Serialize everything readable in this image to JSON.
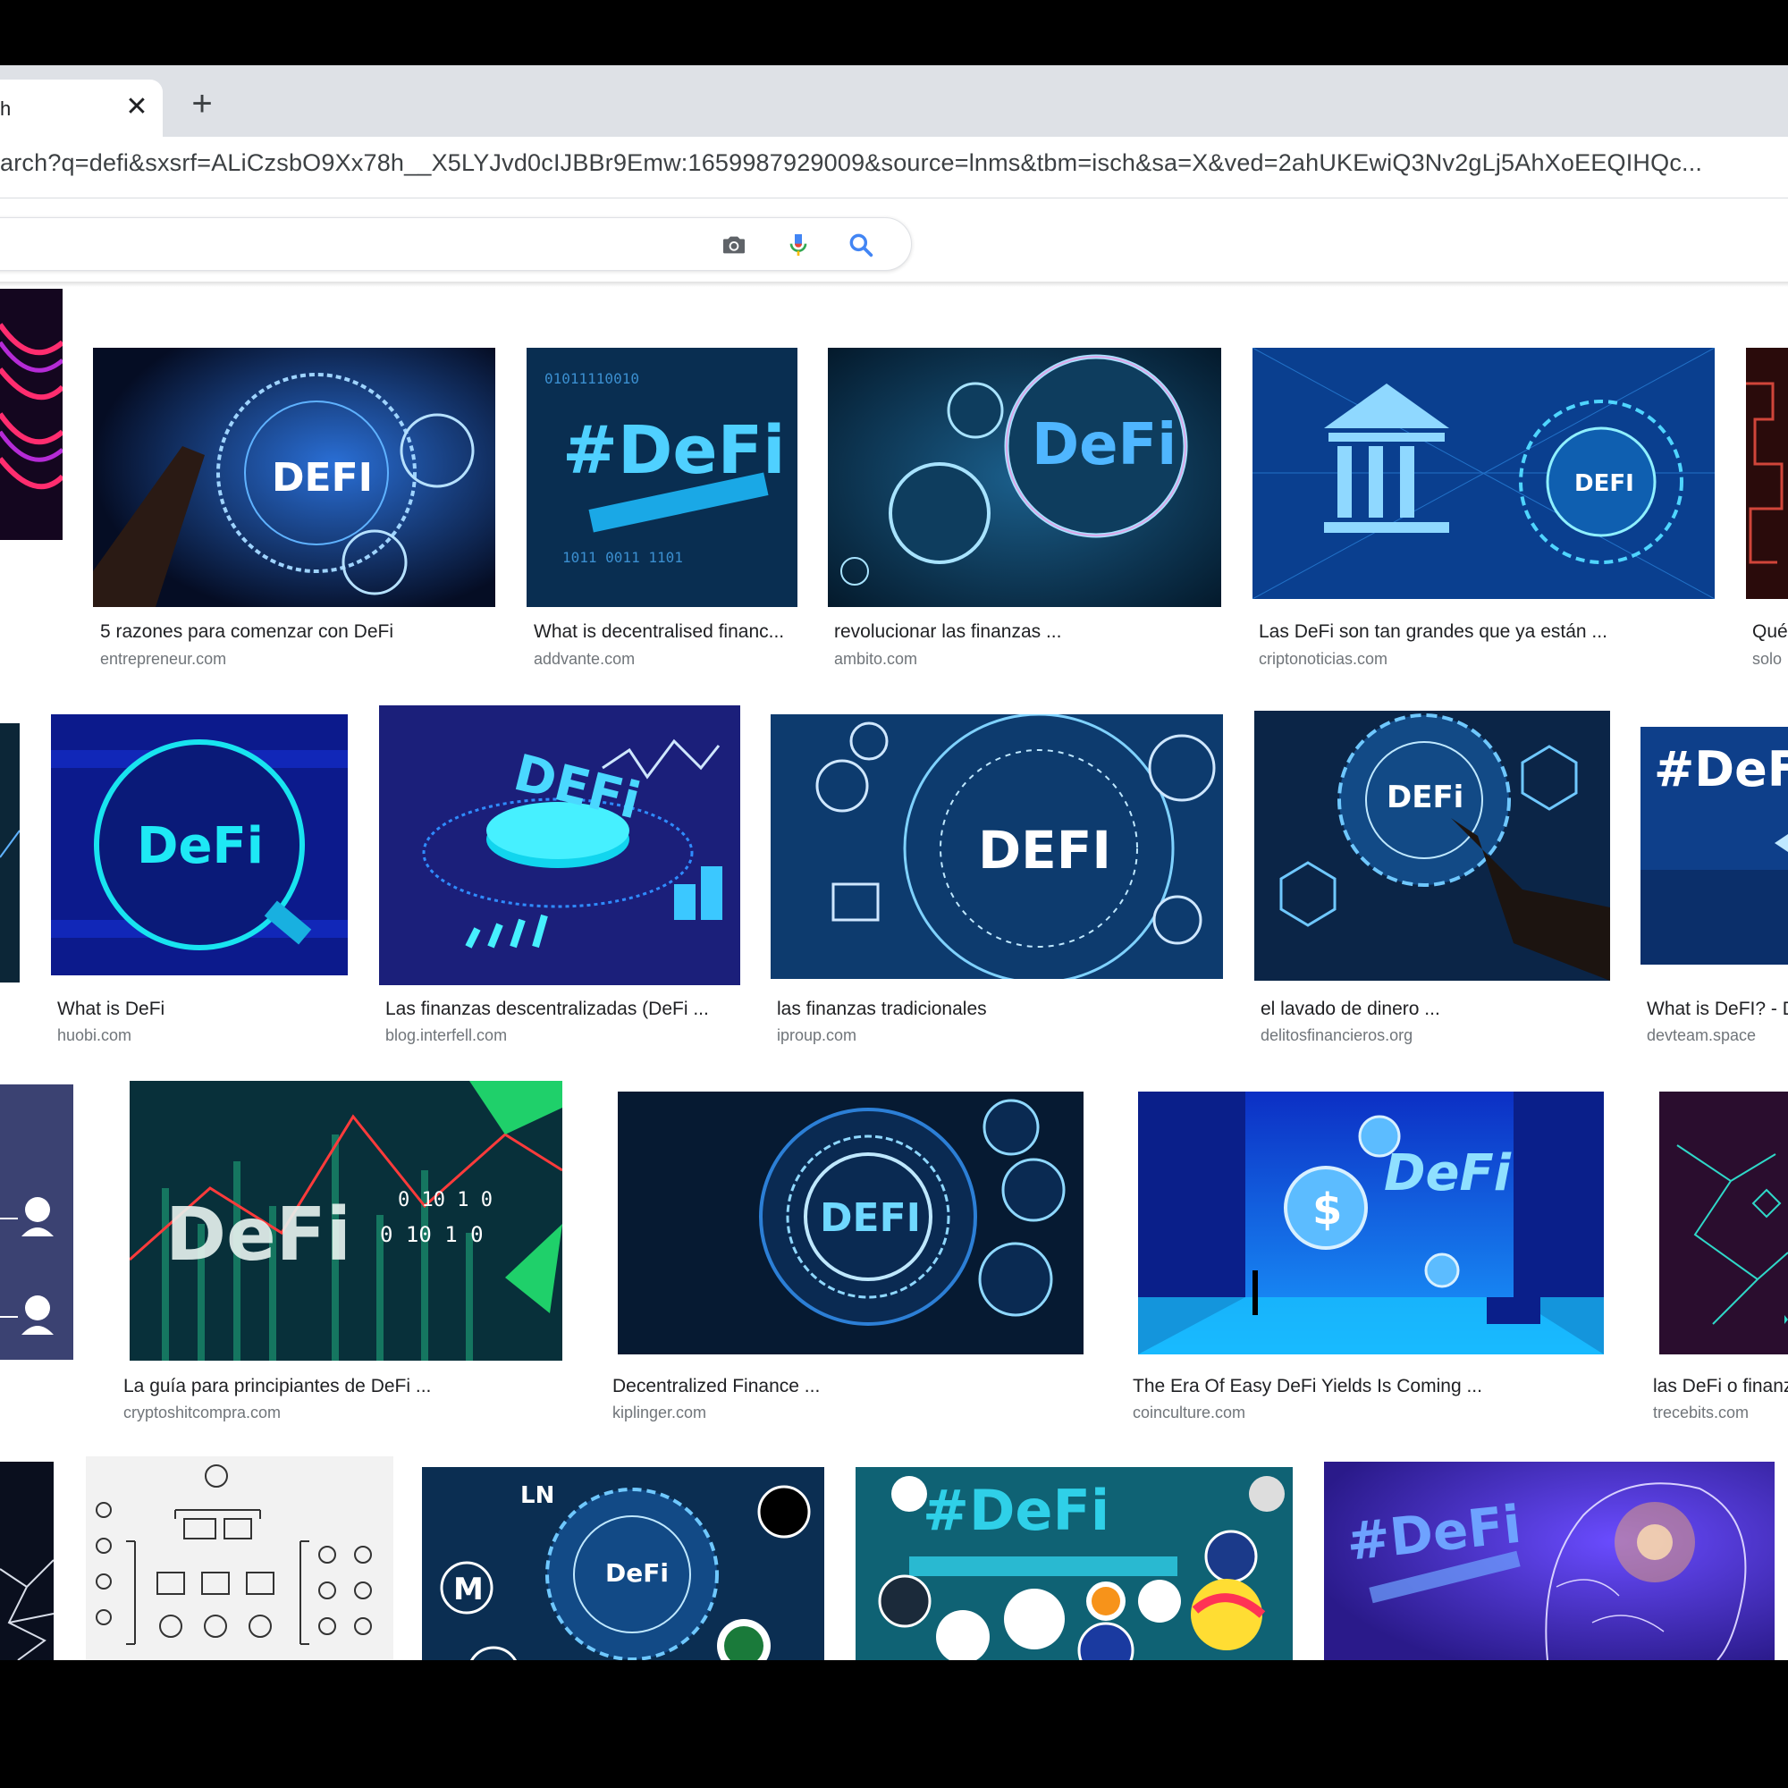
{
  "tab": {
    "title": "h",
    "close_glyph": "✕",
    "new_glyph": "+"
  },
  "address_bar": {
    "url": "arch?q=defi&sxsrf=ALiCzsbO9Xx78h__X5LYJvd0cIJBBr9Emw:1659987929009&source=lnms&tbm=isch&sa=X&ved=2ahUKEwiQ3Nv2gLj5AhXoEEQIHQc..."
  },
  "search_bar": {
    "icons": [
      "camera-icon",
      "mic-icon",
      "search-icon"
    ],
    "accent_colors": {
      "blue": "#4285f4",
      "red": "#ea4335",
      "gray": "#5f6368"
    }
  },
  "results": {
    "row1": [
      {
        "title": "",
        "site": "",
        "thumb_text": ""
      },
      {
        "title": "5 razones para comenzar con DeFi",
        "site": "entrepreneur.com",
        "thumb_text": "DEFI"
      },
      {
        "title": "What is decentralised financ...",
        "site": "addvante.com",
        "thumb_text": "#DeFi"
      },
      {
        "title": "revolucionar las finanzas ...",
        "site": "ambito.com",
        "thumb_text": "DeFi"
      },
      {
        "title": "Las DeFi son tan grandes que ya están ...",
        "site": "criptonoticias.com",
        "thumb_text": "DEFI"
      },
      {
        "title": "Qué",
        "site": "solo",
        "thumb_text": ""
      }
    ],
    "row2": [
      {
        "title": "",
        "site": "",
        "thumb_text": ""
      },
      {
        "title": "What is DeFi",
        "site": "huobi.com",
        "thumb_text": "DeFi"
      },
      {
        "title": "Las finanzas descentralizadas (DeFi ...",
        "site": "blog.interfell.com",
        "thumb_text": "DEFi"
      },
      {
        "title": "las finanzas tradicionales",
        "site": "iproup.com",
        "thumb_text": "DEFI"
      },
      {
        "title": "el lavado de dinero ...",
        "site": "delitosfinancieros.org",
        "thumb_text": "DEFi"
      },
      {
        "title": "What is DeFI? - D",
        "site": "devteam.space",
        "thumb_text": "#DeF"
      }
    ],
    "row3": [
      {
        "title": "",
        "site": "",
        "thumb_text": ""
      },
      {
        "title": "La guía para principiantes de DeFi ...",
        "site": "cryptoshitcompra.com",
        "thumb_text": "DeFi"
      },
      {
        "title": "Decentralized Finance ...",
        "site": "kiplinger.com",
        "thumb_text": "DEFI"
      },
      {
        "title": "The Era Of Easy DeFi Yields Is Coming ...",
        "site": "coinculture.com",
        "thumb_text": "DeFi"
      },
      {
        "title": "las DeFi o finanz",
        "site": "trecebits.com",
        "thumb_text": ""
      }
    ],
    "row4": [
      {
        "thumb_text": ""
      },
      {
        "thumb_text": ""
      },
      {
        "thumb_text": "DeFi"
      },
      {
        "thumb_text": "#DeFi"
      },
      {
        "thumb_text": "#DeFi"
      }
    ]
  }
}
